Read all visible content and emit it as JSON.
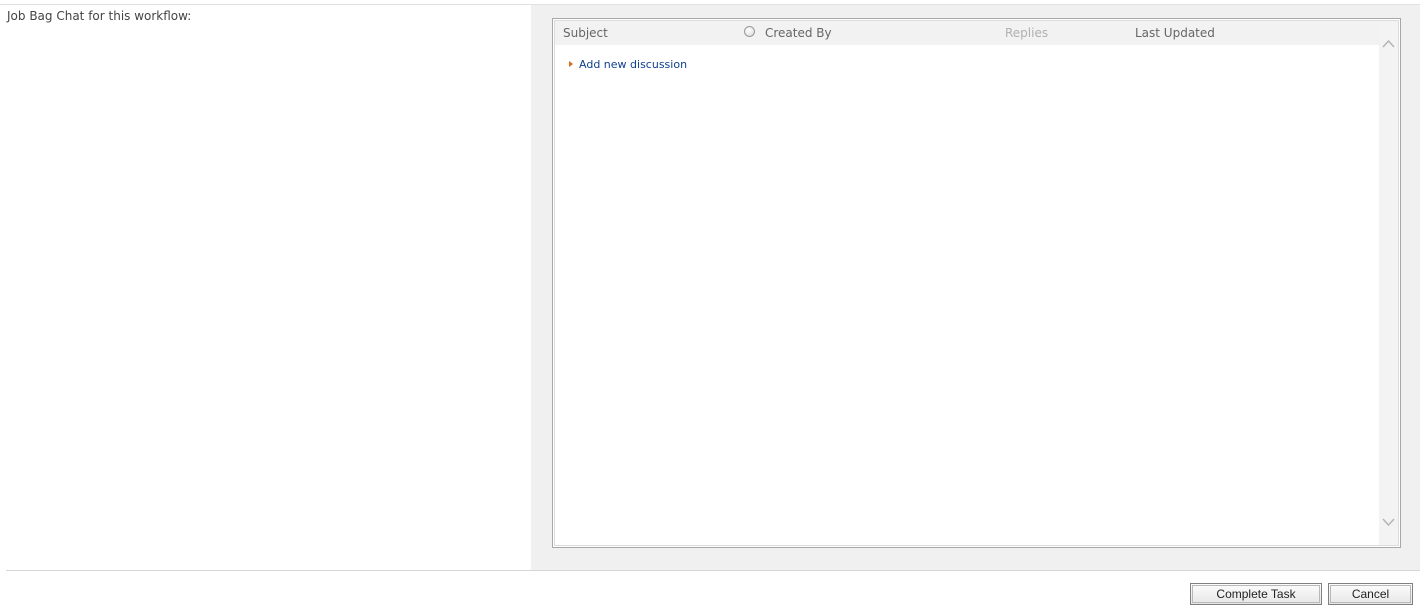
{
  "form": {
    "label": "Job Bag Chat for this workflow:"
  },
  "discussion_list": {
    "columns": {
      "subject": "Subject",
      "created_by": "Created By",
      "replies": "Replies",
      "last_updated": "Last Updated"
    },
    "add_link": "Add new discussion"
  },
  "buttons": {
    "complete": "Complete Task",
    "cancel": "Cancel"
  },
  "icons": {
    "arrow": "bullet-arrow-icon",
    "scroll_up": "chevron-up-icon",
    "scroll_down": "chevron-down-icon",
    "radio": "radio-icon"
  },
  "colors": {
    "link": "#0f3f8f",
    "bullet": "#d86a1a",
    "panel_bg": "#f0f0f0"
  }
}
